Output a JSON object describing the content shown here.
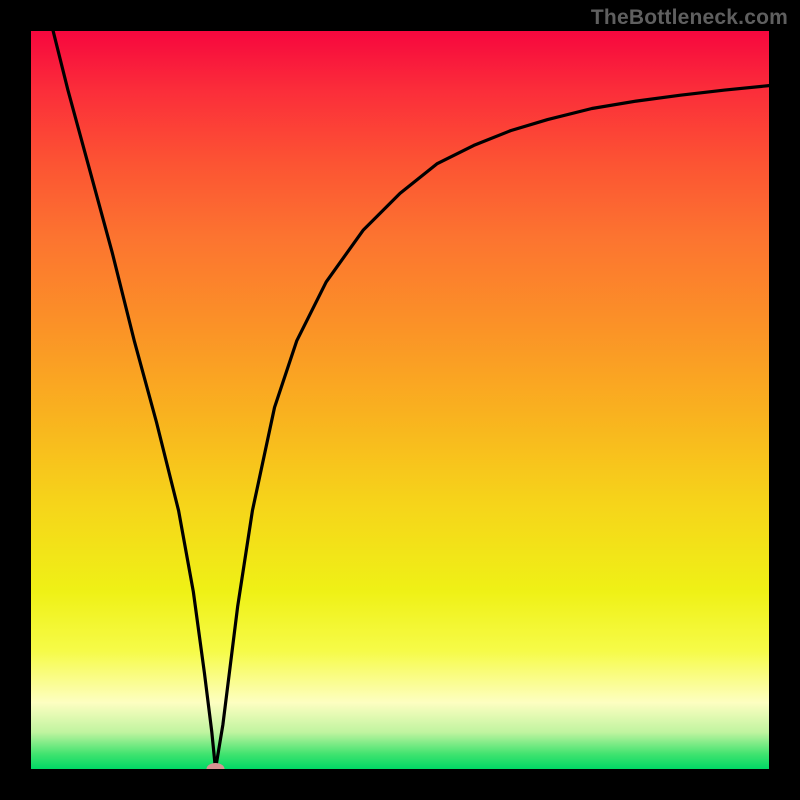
{
  "watermark": "TheBottleneck.com",
  "chart_data": {
    "type": "line",
    "title": "",
    "xlabel": "",
    "ylabel": "",
    "xlim": [
      0,
      100
    ],
    "ylim": [
      0,
      100
    ],
    "grid": false,
    "series": [
      {
        "name": "curve",
        "x": [
          3,
          5,
          8,
          11,
          14,
          17,
          20,
          22,
          23.5,
          24.5,
          25,
          26,
          27,
          28,
          30,
          33,
          36,
          40,
          45,
          50,
          55,
          60,
          65,
          70,
          76,
          82,
          88,
          94,
          100
        ],
        "y": [
          100,
          92,
          81,
          70,
          58,
          47,
          35,
          24,
          13,
          5,
          0,
          6,
          14,
          22,
          35,
          49,
          58,
          66,
          73,
          78,
          82,
          84.5,
          86.5,
          88,
          89.5,
          90.5,
          91.3,
          92,
          92.6
        ]
      }
    ],
    "marker": {
      "x": 25,
      "y": 0,
      "color": "#d79392"
    }
  }
}
